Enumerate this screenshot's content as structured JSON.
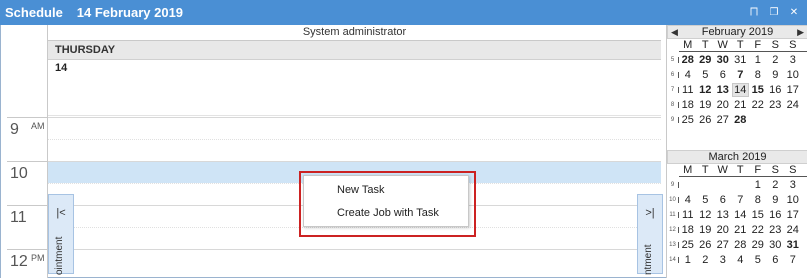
{
  "titlebar": {
    "title": "Schedule",
    "date": "14 February 2019",
    "buttons": [
      "pin-icon",
      "restore-icon",
      "close-icon"
    ]
  },
  "scheduler": {
    "resource": "System administrator",
    "day_name": "THURSDAY",
    "day_num": "14",
    "hours": [
      {
        "num": "9",
        "suffix": "AM"
      },
      {
        "num": "10",
        "suffix": ""
      },
      {
        "num": "11",
        "suffix": ""
      },
      {
        "num": "12",
        "suffix": "PM"
      }
    ],
    "prev_tab": {
      "arrow": "|<",
      "text": "ointment"
    },
    "next_tab": {
      "arrow": ">|",
      "text": "ntment"
    }
  },
  "context_menu": {
    "items": [
      "New Task",
      "Create Job with Task"
    ]
  },
  "calendars": [
    {
      "title": "February 2019",
      "dow": [
        "M",
        "T",
        "W",
        "T",
        "F",
        "S",
        "S"
      ],
      "weeks": [
        {
          "wn": "5",
          "days": [
            "28",
            "29",
            "30",
            "31",
            "1",
            "2",
            "3"
          ]
        },
        {
          "wn": "6",
          "days": [
            "4",
            "5",
            "6",
            "7",
            "8",
            "9",
            "10"
          ]
        },
        {
          "wn": "7",
          "days": [
            "11",
            "12",
            "13",
            "14",
            "15",
            "16",
            "17"
          ]
        },
        {
          "wn": "8",
          "days": [
            "18",
            "19",
            "20",
            "21",
            "22",
            "23",
            "24"
          ]
        },
        {
          "wn": "9",
          "days": [
            "25",
            "26",
            "27",
            "28",
            "",
            "",
            ""
          ]
        }
      ]
    },
    {
      "title": "March 2019",
      "dow": [
        "M",
        "T",
        "W",
        "T",
        "F",
        "S",
        "S"
      ],
      "weeks": [
        {
          "wn": "9",
          "days": [
            "",
            "",
            "",
            "",
            "1",
            "2",
            "3"
          ]
        },
        {
          "wn": "10",
          "days": [
            "4",
            "5",
            "6",
            "7",
            "8",
            "9",
            "10"
          ]
        },
        {
          "wn": "11",
          "days": [
            "11",
            "12",
            "13",
            "14",
            "15",
            "16",
            "17"
          ]
        },
        {
          "wn": "12",
          "days": [
            "18",
            "19",
            "20",
            "21",
            "22",
            "23",
            "24"
          ]
        },
        {
          "wn": "13",
          "days": [
            "25",
            "26",
            "27",
            "28",
            "29",
            "30",
            "31"
          ]
        },
        {
          "wn": "14",
          "days": [
            "1",
            "2",
            "3",
            "4",
            "5",
            "6",
            "7"
          ]
        }
      ]
    }
  ]
}
